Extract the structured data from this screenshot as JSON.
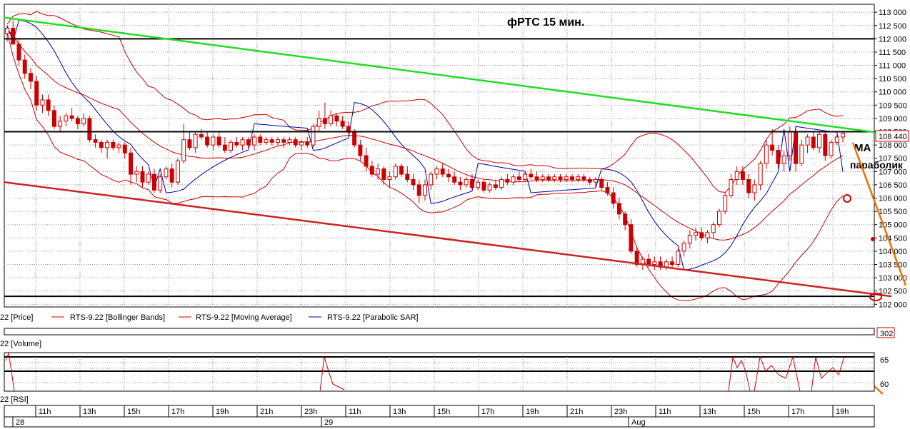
{
  "chart_data": {
    "type": "candlestick",
    "title": "фРТС   15 мин.",
    "yaxis_ticks": [
      "113 000",
      "112 500",
      "112 000",
      "111 500",
      "111 000",
      "110 500",
      "110 000",
      "109 500",
      "109 000",
      "108 500",
      "108 000",
      "107 500",
      "107 000",
      "106 500",
      "106 000",
      "105 500",
      "105 000",
      "104 500",
      "104 000",
      "103 500",
      "103 000",
      "102 500",
      "102 000"
    ],
    "ylim": [
      102000,
      113000
    ],
    "last_price_label": "108 440",
    "annotations": {
      "ma": "MA",
      "parabolic": "параболик"
    },
    "horizontal_levels": [
      112000,
      108500,
      102300
    ],
    "trend_lines": [
      {
        "color": "green",
        "from": {
          "x": 0,
          "y": 112800
        },
        "to": {
          "x": 1.0,
          "y": 108400
        }
      },
      {
        "color": "red",
        "from": {
          "x": 0,
          "y": 106600
        },
        "to": {
          "x": 1.0,
          "y": 102300
        }
      }
    ],
    "legend": [
      {
        "label": "22 [Price]",
        "color": "#cc0000"
      },
      {
        "label": "RTS-9.22 [Bollinger Bands]",
        "color": "#cc0000"
      },
      {
        "label": "RTS-9.22 [Moving Average]",
        "color": "#cc0000"
      },
      {
        "label": "RTS-9.22 [Parabolic SAR]",
        "color": "#0000aa"
      }
    ],
    "volume_panel": {
      "label": "22 [Volume]",
      "value_label": "302"
    },
    "rsi_panel": {
      "label": "22 [RSI]",
      "ticks": [
        "65",
        "60"
      ],
      "levels": [
        65,
        60
      ]
    },
    "time_axis": {
      "hour_labels": [
        "11h",
        "13h",
        "15h",
        "17h",
        "19h",
        "21h",
        "23h",
        "11h",
        "13h",
        "15h",
        "17h",
        "19h",
        "21h",
        "23h",
        "11h",
        "13h",
        "15h",
        "17h",
        "19h"
      ],
      "day_labels": [
        "28",
        "29",
        "Aug"
      ]
    },
    "candles": [
      {
        "o": 112200,
        "h": 112500,
        "l": 111900,
        "c": 112400
      },
      {
        "o": 112400,
        "h": 112700,
        "l": 112000,
        "c": 111800
      },
      {
        "o": 111800,
        "h": 112000,
        "l": 111000,
        "c": 111200
      },
      {
        "o": 111200,
        "h": 111400,
        "l": 110500,
        "c": 110700
      },
      {
        "o": 110700,
        "h": 110900,
        "l": 110100,
        "c": 110400
      },
      {
        "o": 110400,
        "h": 110600,
        "l": 109300,
        "c": 109500
      },
      {
        "o": 109500,
        "h": 109900,
        "l": 109200,
        "c": 109700
      },
      {
        "o": 109700,
        "h": 109900,
        "l": 109100,
        "c": 109300
      },
      {
        "o": 109300,
        "h": 109500,
        "l": 108600,
        "c": 108700
      },
      {
        "o": 108700,
        "h": 109100,
        "l": 108500,
        "c": 108900
      },
      {
        "o": 108900,
        "h": 109200,
        "l": 108700,
        "c": 109100
      },
      {
        "o": 109100,
        "h": 109400,
        "l": 108900,
        "c": 109000
      },
      {
        "o": 109000,
        "h": 109100,
        "l": 108600,
        "c": 108800
      },
      {
        "o": 108800,
        "h": 109200,
        "l": 108700,
        "c": 109000
      },
      {
        "o": 109000,
        "h": 109100,
        "l": 108100,
        "c": 108200
      },
      {
        "o": 108200,
        "h": 108400,
        "l": 107900,
        "c": 108100
      },
      {
        "o": 108100,
        "h": 108200,
        "l": 107700,
        "c": 107900
      },
      {
        "o": 107900,
        "h": 108200,
        "l": 107500,
        "c": 108100
      },
      {
        "o": 108100,
        "h": 108200,
        "l": 107800,
        "c": 107900
      },
      {
        "o": 107900,
        "h": 108100,
        "l": 107700,
        "c": 108000
      },
      {
        "o": 108000,
        "h": 108100,
        "l": 107500,
        "c": 107700
      },
      {
        "o": 107700,
        "h": 107900,
        "l": 106500,
        "c": 106900
      },
      {
        "o": 106900,
        "h": 107200,
        "l": 106600,
        "c": 107000
      },
      {
        "o": 107000,
        "h": 107200,
        "l": 106400,
        "c": 106600
      },
      {
        "o": 106600,
        "h": 107000,
        "l": 106500,
        "c": 106900
      },
      {
        "o": 106900,
        "h": 107100,
        "l": 106200,
        "c": 106300
      },
      {
        "o": 106300,
        "h": 106900,
        "l": 106200,
        "c": 106800
      },
      {
        "o": 106800,
        "h": 107200,
        "l": 106700,
        "c": 107100
      },
      {
        "o": 107100,
        "h": 107300,
        "l": 106400,
        "c": 106600
      },
      {
        "o": 106600,
        "h": 107500,
        "l": 106500,
        "c": 107400
      },
      {
        "o": 107400,
        "h": 108800,
        "l": 107300,
        "c": 108200
      },
      {
        "o": 108200,
        "h": 108500,
        "l": 107800,
        "c": 107900
      },
      {
        "o": 107900,
        "h": 108500,
        "l": 107700,
        "c": 108400
      },
      {
        "o": 108400,
        "h": 108600,
        "l": 108200,
        "c": 108300
      },
      {
        "o": 108300,
        "h": 108500,
        "l": 107900,
        "c": 108000
      },
      {
        "o": 108000,
        "h": 108400,
        "l": 107800,
        "c": 108300
      },
      {
        "o": 108300,
        "h": 108500,
        "l": 107900,
        "c": 108000
      },
      {
        "o": 108000,
        "h": 108300,
        "l": 107700,
        "c": 107800
      },
      {
        "o": 107800,
        "h": 108200,
        "l": 107700,
        "c": 108100
      },
      {
        "o": 108100,
        "h": 108300,
        "l": 107900,
        "c": 108000
      },
      {
        "o": 108000,
        "h": 108300,
        "l": 107800,
        "c": 108200
      },
      {
        "o": 108200,
        "h": 108300,
        "l": 107900,
        "c": 108000
      },
      {
        "o": 108000,
        "h": 108400,
        "l": 107800,
        "c": 108300
      },
      {
        "o": 108300,
        "h": 108400,
        "l": 108000,
        "c": 108100
      },
      {
        "o": 108100,
        "h": 108300,
        "l": 108000,
        "c": 108200
      },
      {
        "o": 108200,
        "h": 108300,
        "l": 108000,
        "c": 108100
      },
      {
        "o": 108100,
        "h": 108300,
        "l": 108000,
        "c": 108200
      },
      {
        "o": 108200,
        "h": 108300,
        "l": 107900,
        "c": 108100
      },
      {
        "o": 108100,
        "h": 108300,
        "l": 108000,
        "c": 108200
      },
      {
        "o": 108200,
        "h": 108300,
        "l": 107900,
        "c": 108000
      },
      {
        "o": 108000,
        "h": 108200,
        "l": 107800,
        "c": 108100
      },
      {
        "o": 108100,
        "h": 108300,
        "l": 107900,
        "c": 108000
      },
      {
        "o": 108000,
        "h": 108800,
        "l": 107900,
        "c": 108700
      },
      {
        "o": 108700,
        "h": 109300,
        "l": 108500,
        "c": 109000
      },
      {
        "o": 109000,
        "h": 109600,
        "l": 108600,
        "c": 108800
      },
      {
        "o": 108800,
        "h": 109300,
        "l": 108700,
        "c": 109100
      },
      {
        "o": 109100,
        "h": 109200,
        "l": 108700,
        "c": 108900
      },
      {
        "o": 108900,
        "h": 109100,
        "l": 108600,
        "c": 108700
      },
      {
        "o": 108700,
        "h": 108900,
        "l": 108400,
        "c": 108500
      },
      {
        "o": 108500,
        "h": 108600,
        "l": 107900,
        "c": 108000
      },
      {
        "o": 108000,
        "h": 108200,
        "l": 107400,
        "c": 107600
      },
      {
        "o": 107600,
        "h": 107900,
        "l": 107000,
        "c": 107200
      },
      {
        "o": 107200,
        "h": 107400,
        "l": 106800,
        "c": 106900
      },
      {
        "o": 106900,
        "h": 107300,
        "l": 106700,
        "c": 107100
      },
      {
        "o": 107100,
        "h": 107200,
        "l": 106500,
        "c": 106700
      },
      {
        "o": 106700,
        "h": 107000,
        "l": 106400,
        "c": 106800
      },
      {
        "o": 106800,
        "h": 107300,
        "l": 106700,
        "c": 107200
      },
      {
        "o": 107200,
        "h": 107300,
        "l": 106800,
        "c": 106900
      },
      {
        "o": 106900,
        "h": 107200,
        "l": 106600,
        "c": 106700
      },
      {
        "o": 106700,
        "h": 106900,
        "l": 106300,
        "c": 106500
      },
      {
        "o": 106500,
        "h": 106700,
        "l": 105800,
        "c": 106100
      },
      {
        "o": 106100,
        "h": 106700,
        "l": 105900,
        "c": 106500
      },
      {
        "o": 106500,
        "h": 107000,
        "l": 106300,
        "c": 106900
      },
      {
        "o": 106900,
        "h": 107200,
        "l": 106700,
        "c": 107100
      },
      {
        "o": 107100,
        "h": 107300,
        "l": 106800,
        "c": 106900
      },
      {
        "o": 106900,
        "h": 107100,
        "l": 106600,
        "c": 106800
      },
      {
        "o": 106800,
        "h": 107000,
        "l": 106500,
        "c": 106600
      },
      {
        "o": 106600,
        "h": 106800,
        "l": 106300,
        "c": 106500
      },
      {
        "o": 106500,
        "h": 106800,
        "l": 106400,
        "c": 106700
      },
      {
        "o": 106700,
        "h": 106900,
        "l": 106300,
        "c": 106400
      },
      {
        "o": 106400,
        "h": 106700,
        "l": 106300,
        "c": 106600
      },
      {
        "o": 106600,
        "h": 106700,
        "l": 106200,
        "c": 106300
      },
      {
        "o": 106300,
        "h": 106600,
        "l": 106200,
        "c": 106500
      },
      {
        "o": 106500,
        "h": 106700,
        "l": 106300,
        "c": 106400
      },
      {
        "o": 106400,
        "h": 106800,
        "l": 106300,
        "c": 106700
      },
      {
        "o": 106700,
        "h": 106900,
        "l": 106500,
        "c": 106600
      },
      {
        "o": 106600,
        "h": 106900,
        "l": 106500,
        "c": 106800
      },
      {
        "o": 106800,
        "h": 107000,
        "l": 106600,
        "c": 106700
      },
      {
        "o": 106700,
        "h": 107000,
        "l": 106600,
        "c": 106900
      },
      {
        "o": 106900,
        "h": 107100,
        "l": 106700,
        "c": 106800
      },
      {
        "o": 106800,
        "h": 107000,
        "l": 106600,
        "c": 106700
      },
      {
        "o": 106700,
        "h": 106900,
        "l": 106600,
        "c": 106800
      },
      {
        "o": 106800,
        "h": 106900,
        "l": 106600,
        "c": 106700
      },
      {
        "o": 106700,
        "h": 106900,
        "l": 106600,
        "c": 106800
      },
      {
        "o": 106800,
        "h": 106900,
        "l": 106600,
        "c": 106700
      },
      {
        "o": 106700,
        "h": 106900,
        "l": 106600,
        "c": 106800
      },
      {
        "o": 106800,
        "h": 106900,
        "l": 106600,
        "c": 106700
      },
      {
        "o": 106700,
        "h": 106900,
        "l": 106600,
        "c": 106800
      },
      {
        "o": 106800,
        "h": 106900,
        "l": 106600,
        "c": 106700
      },
      {
        "o": 106700,
        "h": 106800,
        "l": 106500,
        "c": 106600
      },
      {
        "o": 106600,
        "h": 106800,
        "l": 106400,
        "c": 106700
      },
      {
        "o": 106700,
        "h": 106800,
        "l": 106300,
        "c": 106400
      },
      {
        "o": 106400,
        "h": 106600,
        "l": 106100,
        "c": 106200
      },
      {
        "o": 106200,
        "h": 106400,
        "l": 105600,
        "c": 105800
      },
      {
        "o": 105800,
        "h": 106000,
        "l": 105200,
        "c": 105400
      },
      {
        "o": 105400,
        "h": 105500,
        "l": 104800,
        "c": 105000
      },
      {
        "o": 105000,
        "h": 105200,
        "l": 103900,
        "c": 104000
      },
      {
        "o": 104000,
        "h": 104200,
        "l": 103400,
        "c": 103500
      },
      {
        "o": 103500,
        "h": 103800,
        "l": 103300,
        "c": 103700
      },
      {
        "o": 103700,
        "h": 103900,
        "l": 103400,
        "c": 103500
      },
      {
        "o": 103500,
        "h": 103800,
        "l": 103300,
        "c": 103600
      },
      {
        "o": 103600,
        "h": 103800,
        "l": 103300,
        "c": 103400
      },
      {
        "o": 103400,
        "h": 103700,
        "l": 103300,
        "c": 103600
      },
      {
        "o": 103600,
        "h": 103800,
        "l": 103400,
        "c": 103500
      },
      {
        "o": 103500,
        "h": 104100,
        "l": 103400,
        "c": 104000
      },
      {
        "o": 104000,
        "h": 104400,
        "l": 103800,
        "c": 104300
      },
      {
        "o": 104300,
        "h": 104800,
        "l": 104100,
        "c": 104600
      },
      {
        "o": 104600,
        "h": 104900,
        "l": 104400,
        "c": 104700
      },
      {
        "o": 104700,
        "h": 104900,
        "l": 104400,
        "c": 104500
      },
      {
        "o": 104500,
        "h": 104800,
        "l": 104300,
        "c": 104700
      },
      {
        "o": 104700,
        "h": 105100,
        "l": 104500,
        "c": 105000
      },
      {
        "o": 105000,
        "h": 105600,
        "l": 104900,
        "c": 105500
      },
      {
        "o": 105500,
        "h": 106200,
        "l": 105400,
        "c": 106100
      },
      {
        "o": 106100,
        "h": 106900,
        "l": 106000,
        "c": 106700
      },
      {
        "o": 106700,
        "h": 107200,
        "l": 106500,
        "c": 107000
      },
      {
        "o": 107000,
        "h": 107200,
        "l": 106500,
        "c": 106700
      },
      {
        "o": 106700,
        "h": 106900,
        "l": 106000,
        "c": 106200
      },
      {
        "o": 106200,
        "h": 106700,
        "l": 105900,
        "c": 106500
      },
      {
        "o": 106500,
        "h": 107400,
        "l": 106300,
        "c": 107300
      },
      {
        "o": 107300,
        "h": 108200,
        "l": 107100,
        "c": 108000
      },
      {
        "o": 108000,
        "h": 108600,
        "l": 107600,
        "c": 107800
      },
      {
        "o": 107800,
        "h": 108000,
        "l": 107100,
        "c": 107300
      },
      {
        "o": 107300,
        "h": 107800,
        "l": 107000,
        "c": 107600
      },
      {
        "o": 107600,
        "h": 108700,
        "l": 107400,
        "c": 108500
      },
      {
        "o": 108500,
        "h": 108600,
        "l": 107000,
        "c": 107300
      },
      {
        "o": 107300,
        "h": 108200,
        "l": 107200,
        "c": 108000
      },
      {
        "o": 108000,
        "h": 108400,
        "l": 107700,
        "c": 108300
      },
      {
        "o": 108300,
        "h": 108500,
        "l": 107800,
        "c": 107900
      },
      {
        "o": 107900,
        "h": 108500,
        "l": 107700,
        "c": 108400
      },
      {
        "o": 108400,
        "h": 108500,
        "l": 107400,
        "c": 107600
      },
      {
        "o": 107600,
        "h": 108200,
        "l": 107500,
        "c": 108100
      },
      {
        "o": 108100,
        "h": 108400,
        "l": 108000,
        "c": 108300
      },
      {
        "o": 108300,
        "h": 108500,
        "l": 108100,
        "c": 108440
      }
    ]
  }
}
